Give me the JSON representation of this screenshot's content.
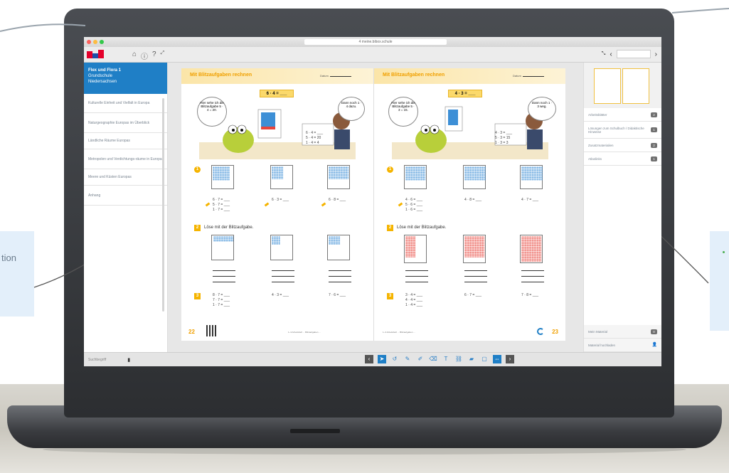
{
  "callouts": {
    "left_text": "tion"
  },
  "browser": {
    "url": "4 meine.bibox.schule"
  },
  "sidebar": {
    "book": {
      "title": "Flex und Flora 1",
      "subtitle1": "Grundschule",
      "subtitle2": "Niedersachsen"
    },
    "items": [
      {
        "label": "Kulturelle Einheit und Vielfalt in Europa"
      },
      {
        "label": "Naturgeographie Europas im Überblick"
      },
      {
        "label": "Ländliche Räume Europas"
      },
      {
        "label": "Metropolen und Verdichtungs-räume in Europa"
      },
      {
        "label": "Meere und Küsten Europas"
      },
      {
        "label": "Anhang"
      }
    ],
    "search_placeholder": "Suchbegriff"
  },
  "pages": {
    "left": {
      "title": "Mit Blitzaufgaben rechnen",
      "date_label": "Datum",
      "equation_box": "6 · 4 = ___",
      "bubble_left": "Hier sehe ich die Blitzaufgabe 5 · 4 = 20.",
      "bubble_right": "Dann noch 1 · 4 dazu.",
      "board": [
        "6 · 4 = ___",
        "5 · 4 = 20",
        "1 · 4 = 4"
      ],
      "task1_eqs": [
        "6 · 7 = ___",
        "5 · 7 = ___",
        "1 · 7 = ___"
      ],
      "task1_b": "6 · 3 = ___",
      "task1_c": "6 · 8 = ___",
      "task2_label": "Löse mit der Blitzaufgabe.",
      "task3_a": [
        "8 · 7 = ___",
        "7 · 7 = ___",
        "1 · 7 = ___"
      ],
      "task3_b": "4 · 3 = ___",
      "task3_c": "7 · 6 = ___",
      "page_number": "22",
      "footnote": "1–3 Arbeitsheft ... Blitzaufgaben ..."
    },
    "right": {
      "title": "Mit Blitzaufgaben rechnen",
      "date_label": "Datum",
      "equation_box": "4 · 3 = ___",
      "bubble_left": "Hier sehe ich die Blitzaufgabe 5 · 3 = 15.",
      "bubble_right": "Dann noch 1 · 3 weg.",
      "board": [
        "4 · 3 = ___",
        "5 · 3 = 15",
        "1 · 3 = 3"
      ],
      "task1_eqs": [
        "4 · 6 = ___",
        "5 · 6 = ___",
        "1 · 6 = ___"
      ],
      "task1_b": "4 · 8 = ___",
      "task1_c": "4 · 7 = ___",
      "task2_label": "Löse mit der Blitzaufgabe.",
      "task3_a": [
        "3 · 4 = ___",
        "4 · 4 = ___",
        "1 · 4 = ___"
      ],
      "task3_b": "6 · 7 = ___",
      "task3_c": "7 · 8 = ___",
      "page_number": "23",
      "footnote": "1–3 Arbeitsheft ... Blitzaufgaben ..."
    }
  },
  "right_panel": {
    "items": [
      {
        "label": "Arbeitsblätter",
        "count": "2"
      },
      {
        "label": "Lösungen zum Schulbuch / Didaktische Hinweise",
        "count": "1"
      },
      {
        "label": "Zusatzmaterialien",
        "count": "2"
      },
      {
        "label": "Atlaslinks",
        "count": "1"
      }
    ],
    "my_material": {
      "label": "Mein Material",
      "count": "0"
    },
    "upload": {
      "label": "Material hochladen"
    }
  },
  "colors": {
    "accent": "#1f7fc6",
    "page_accent": "#f0a000",
    "badge": "#707070"
  }
}
